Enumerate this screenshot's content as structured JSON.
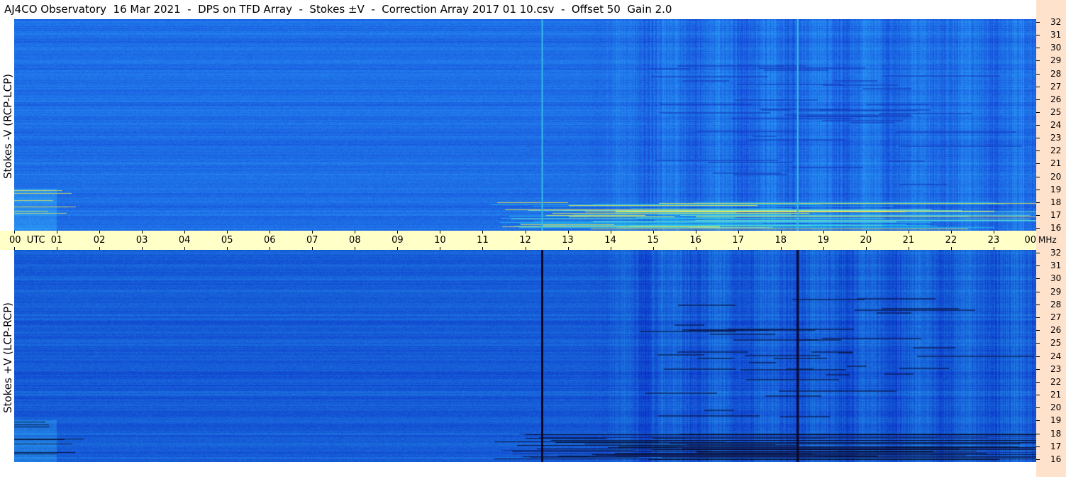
{
  "title": "AJ4CO Observatory  16 Mar 2021  -  DPS on TFD Array  -  Stokes ±V  -  Correction Array 2017 01 10.csv  -  Offset 50  Gain 2.0",
  "panels": [
    {
      "label": "Stokes -V (RCP-LCP)"
    },
    {
      "label": "Stokes +V (LCP-RCP)"
    }
  ],
  "colors": {
    "background_top": "#1a72e6",
    "background_bottom": "#165fd9",
    "time_axis_bg": "#ffffc8",
    "freq_axis_bg": "#ffe2cc",
    "event_line_top": "#36b6e6",
    "event_line_bottom": "#0a0a2a"
  },
  "chart_data": {
    "type": "heatmap",
    "title": "AJ4CO Observatory  16 Mar 2021  -  DPS on TFD Array  -  Stokes ±V  -  Correction Array 2017 01 10.csv  -  Offset 50  Gain 2.0",
    "x_axis": {
      "label": "UTC",
      "ticks": [
        "00",
        "01",
        "02",
        "03",
        "04",
        "05",
        "06",
        "07",
        "08",
        "09",
        "10",
        "11",
        "12",
        "13",
        "14",
        "15",
        "16",
        "17",
        "18",
        "19",
        "20",
        "21",
        "22",
        "23",
        "00"
      ],
      "range_hours": [
        0,
        24
      ]
    },
    "y_axis": {
      "unit": "MHz",
      "ticks": [
        32,
        31,
        30,
        29,
        28,
        27,
        26,
        25,
        24,
        23,
        22,
        21,
        20,
        19,
        18,
        17,
        16
      ],
      "range": [
        16,
        32
      ]
    },
    "panels": [
      "Stokes -V (RCP-LCP)",
      "Stokes +V (LCP-RCP)"
    ],
    "event_lines_utc": [
      12.4,
      18.4
    ],
    "grid": false
  }
}
